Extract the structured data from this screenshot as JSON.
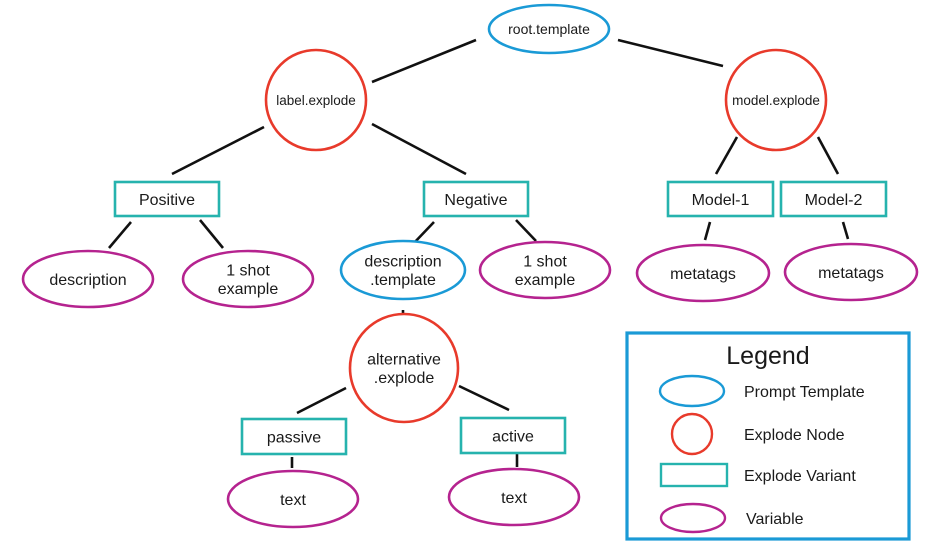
{
  "colors": {
    "template": "#1a9ad6",
    "explode": "#e83a2b",
    "variant": "#26b3ae",
    "variable": "#b5238f",
    "edge": "#111111",
    "legend_border": "#1a9ad6"
  },
  "nodes": {
    "root": {
      "type": "template",
      "lines": [
        "root.template"
      ]
    },
    "label_explode": {
      "type": "explode",
      "lines": [
        "label.explode"
      ]
    },
    "model_explode": {
      "type": "explode",
      "lines": [
        "model.explode"
      ]
    },
    "positive": {
      "type": "variant",
      "lines": [
        "Positive"
      ]
    },
    "negative": {
      "type": "variant",
      "lines": [
        "Negative"
      ]
    },
    "model1": {
      "type": "variant",
      "lines": [
        "Model-1"
      ]
    },
    "model2": {
      "type": "variant",
      "lines": [
        "Model-2"
      ]
    },
    "pos_description": {
      "type": "variable",
      "lines": [
        "description"
      ]
    },
    "pos_one_shot": {
      "type": "variable",
      "lines": [
        "1 shot",
        "example"
      ]
    },
    "desc_template": {
      "type": "template",
      "lines": [
        "description",
        ".template"
      ]
    },
    "neg_one_shot": {
      "type": "variable",
      "lines": [
        "1 shot",
        "example"
      ]
    },
    "metatags1": {
      "type": "variable",
      "lines": [
        "metatags"
      ]
    },
    "metatags2": {
      "type": "variable",
      "lines": [
        "metatags"
      ]
    },
    "alt_explode": {
      "type": "explode",
      "lines": [
        "alternative",
        ".explode"
      ]
    },
    "passive": {
      "type": "variant",
      "lines": [
        "passive"
      ]
    },
    "active": {
      "type": "variant",
      "lines": [
        "active"
      ]
    },
    "text1": {
      "type": "variable",
      "lines": [
        "text"
      ]
    },
    "text2": {
      "type": "variable",
      "lines": [
        "text"
      ]
    }
  },
  "edges": [
    [
      "root",
      "label_explode"
    ],
    [
      "root",
      "model_explode"
    ],
    [
      "label_explode",
      "positive"
    ],
    [
      "label_explode",
      "negative"
    ],
    [
      "model_explode",
      "model1"
    ],
    [
      "model_explode",
      "model2"
    ],
    [
      "positive",
      "pos_description"
    ],
    [
      "positive",
      "pos_one_shot"
    ],
    [
      "negative",
      "desc_template"
    ],
    [
      "negative",
      "neg_one_shot"
    ],
    [
      "model1",
      "metatags1"
    ],
    [
      "model2",
      "metatags2"
    ],
    [
      "desc_template",
      "alt_explode"
    ],
    [
      "alt_explode",
      "passive"
    ],
    [
      "alt_explode",
      "active"
    ],
    [
      "passive",
      "text1"
    ],
    [
      "active",
      "text2"
    ]
  ],
  "legend": {
    "title": "Legend",
    "items": [
      {
        "type": "template",
        "label": "Prompt Template"
      },
      {
        "type": "explode",
        "label": "Explode Node"
      },
      {
        "type": "variant",
        "label": "Explode Variant"
      },
      {
        "type": "variable",
        "label": "Variable"
      }
    ]
  }
}
